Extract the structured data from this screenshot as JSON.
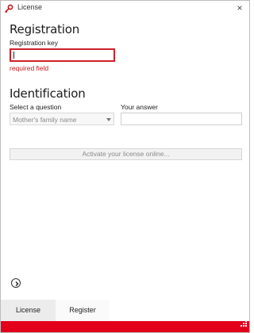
{
  "window": {
    "title": "License",
    "close_glyph": "×",
    "accent_color": "#e3001b"
  },
  "registration": {
    "heading": "Registration",
    "key_label": "Registration key",
    "key_value": "",
    "error_text": "required field"
  },
  "identification": {
    "heading": "Identification",
    "question_label": "Select a question",
    "question_selected": "Mother's family name",
    "answer_label": "Your answer",
    "answer_value": ""
  },
  "actions": {
    "activate_label": "Activate your license online..."
  },
  "tabs": [
    {
      "label": "License",
      "active": true
    },
    {
      "label": "Register",
      "active": false
    }
  ],
  "icons": {
    "app": "key-icon",
    "nav": "chevron-right-circle-icon",
    "grip": "resize-grip-icon"
  }
}
